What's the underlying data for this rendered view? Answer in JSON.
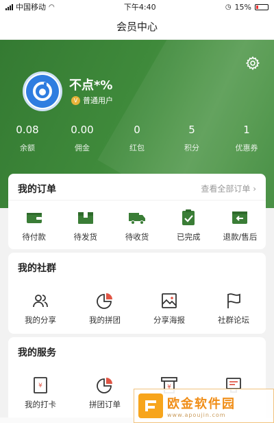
{
  "status": {
    "carrier": "中国移动",
    "time": "下午4:40",
    "battery": "15%"
  },
  "nav": {
    "title": "会员中心"
  },
  "profile": {
    "username": "不点*%",
    "level": "普通用户"
  },
  "stats": [
    {
      "value": "0.08",
      "label": "余额"
    },
    {
      "value": "0.00",
      "label": "佣金"
    },
    {
      "value": "0",
      "label": "红包"
    },
    {
      "value": "5",
      "label": "积分"
    },
    {
      "value": "1",
      "label": "优惠券"
    }
  ],
  "orders": {
    "title": "我的订单",
    "view_all": "查看全部订单",
    "items": [
      {
        "label": "待付款",
        "icon": "wallet-icon"
      },
      {
        "label": "待发货",
        "icon": "package-icon"
      },
      {
        "label": "待收货",
        "icon": "truck-icon"
      },
      {
        "label": "已完成",
        "icon": "clipboard-check-icon"
      },
      {
        "label": "退款/售后",
        "icon": "refund-icon"
      }
    ]
  },
  "community": {
    "title": "我的社群",
    "items": [
      {
        "label": "我的分享",
        "icon": "users-icon"
      },
      {
        "label": "我的拼团",
        "icon": "pie-icon"
      },
      {
        "label": "分享海报",
        "icon": "image-icon"
      },
      {
        "label": "社群论坛",
        "icon": "flag-icon"
      }
    ]
  },
  "services": {
    "title": "我的服务",
    "items": [
      {
        "label": "我的打卡",
        "icon": "checkin-icon"
      },
      {
        "label": "拼团订单",
        "icon": "pie-icon"
      },
      {
        "label": "",
        "icon": "receipt-icon"
      },
      {
        "label": "",
        "icon": "register-icon"
      }
    ]
  },
  "watermark": {
    "title": "欧金软件园",
    "url": "www.apoujin.com"
  },
  "colors": {
    "primary_green": "#3f8a3b",
    "icon_green": "#3a7d36",
    "accent_red": "#e05545"
  }
}
